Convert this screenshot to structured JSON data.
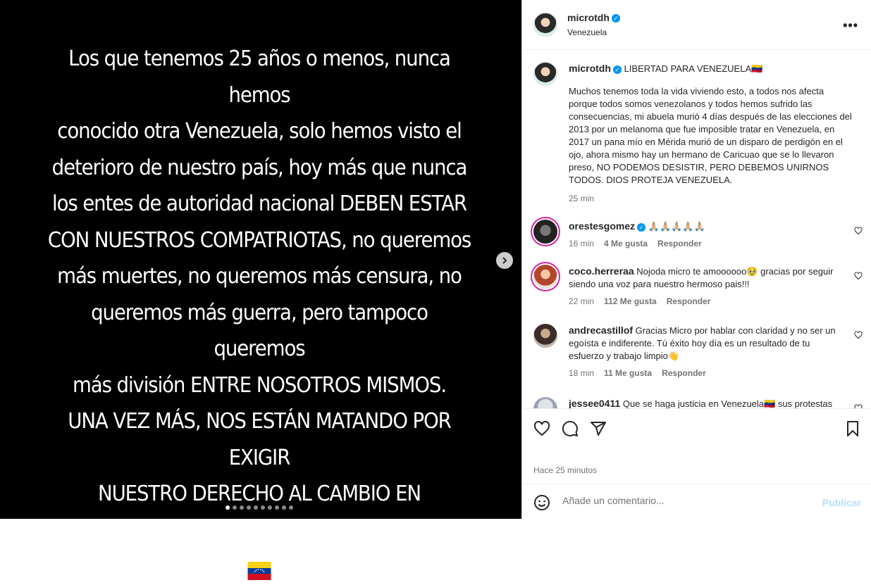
{
  "story": {
    "lines": [
      "Los que tenemos 25 años o menos, nunca hemos",
      "conocido otra Venezuela, solo hemos visto el",
      "deterioro de nuestro país, hoy más que nunca",
      "los entes de autoridad nacional DEBEN ESTAR",
      "CON NUESTROS COMPATRIOTAS, no queremos",
      "más muertes, no queremos más censura, no",
      "queremos más guerra, pero tampoco queremos",
      "más división ENTRE NOSOTROS MISMOS.",
      "UNA VEZ MÁS, NOS ESTÁN MATANDO POR EXIGIR",
      "NUESTRO DERECHO AL CAMBIO EN VENEZUELA"
    ],
    "flag_icon": "venezuela-flag-icon",
    "carousel_count": 10,
    "carousel_active": 1
  },
  "header": {
    "username": "microtdh",
    "location": "Venezuela",
    "more_icon": "more-icon"
  },
  "caption": {
    "username": "microtdh",
    "title": "LIBERTAD PARA VENEZUELA🇻🇪",
    "body": "Muchos tenemos toda la vida viviendo esto, a todos nos afecta porque todos somos venezolanos y todos hemos sufrido las consecuencias, mi abuela murió 4 días después de las elecciones del 2013 por un melanoma que fue imposible tratar en Venezuela, en 2017 un pana mío en Mérida murió de un disparo de perdigón en el ojo, ahora mismo hay un hermano de Caricuao que se lo llevaron preso, NO PODEMOS DESISTIR, PERO DEBEMOS UNIRNOS TODOS. DIOS PROTEJA VENEZUELA.",
    "time": "25 min"
  },
  "comments": [
    {
      "username": "orestesgomez",
      "verified": true,
      "text": "🙏🏼🙏🏼🙏🏼🙏🏼🙏🏼",
      "time": "16 min",
      "likes": "4 Me gusta",
      "reply": "Responder"
    },
    {
      "username": "coco.herreraa",
      "verified": false,
      "text": "Nojoda micro te amoooooo🥹 gracias por seguir siendo una voz para nuestro hermoso pais!!!",
      "time": "22 min",
      "likes": "112 Me gusta",
      "reply": "Responder"
    },
    {
      "username": "andrecastillof",
      "verified": false,
      "text": "Gracias Micro por hablar con claridad y no ser un egoísta e indiferente. Tú éxito hoy día es un resultado de tu esfuerzo y trabajo limpio👋",
      "time": "18 min",
      "likes": "11 Me gusta",
      "reply": "Responder"
    },
    {
      "username": "jessee0411",
      "verified": false,
      "text": "Que se haga justicia en Venezuela🇻🇪 sus protestas",
      "time": "",
      "likes": "",
      "reply": ""
    }
  ],
  "footer": {
    "time": "Hace 25 minutos",
    "comment_placeholder": "Añade un comentario...",
    "post_label": "Publicar"
  },
  "colors": {
    "accent": "#0095f6",
    "post_disabled": "#b2dffc",
    "text": "#262626",
    "muted": "#737373"
  }
}
